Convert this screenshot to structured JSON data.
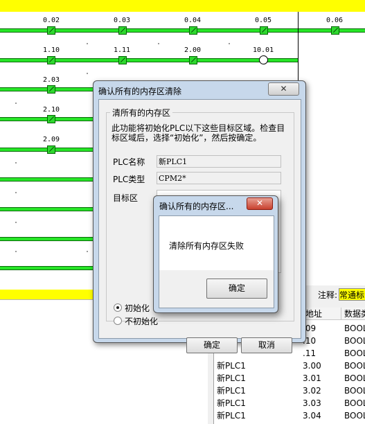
{
  "ladder": {
    "rungs": [
      {
        "contacts": [
          "0.02",
          "0.03",
          "0.04",
          "0.05"
        ],
        "extra": "0.06"
      },
      {
        "contacts": [
          "1.10",
          "1.11",
          "2.00"
        ],
        "coil": "10.01"
      },
      {
        "contacts": [
          "2.03"
        ]
      },
      {
        "contacts": [
          "2.10"
        ]
      },
      {
        "contacts": [
          "2.09"
        ]
      }
    ]
  },
  "note": {
    "label": "注释:",
    "value": "常通标"
  },
  "table": {
    "headers": [
      "地址",
      "数据类"
    ],
    "rows": [
      {
        "name": "",
        "addr": ".09",
        "type": "BOOL"
      },
      {
        "name": "",
        "addr": ".10",
        "type": "BOOL"
      },
      {
        "name": "",
        "addr": ".11",
        "type": "BOOL"
      },
      {
        "name": "新PLC1",
        "addr": "3.00",
        "type": "BOOL"
      },
      {
        "name": "新PLC1",
        "addr": "3.01",
        "type": "BOOL"
      },
      {
        "name": "新PLC1",
        "addr": "3.02",
        "type": "BOOL"
      },
      {
        "name": "新PLC1",
        "addr": "3.03",
        "type": "BOOL"
      },
      {
        "name": "新PLC1",
        "addr": "3.04",
        "type": "BOOL"
      }
    ]
  },
  "dialog": {
    "title": "确认所有的内存区清除",
    "close": "✕",
    "group_title": "清所有的内存区",
    "description": "此功能将初始化PLC以下这些目标区域。检查目标区域后，选择“初始化”，然后按确定。",
    "plc_name_label": "PLC名称",
    "plc_name_value": "新PLC1",
    "plc_type_label": "PLC类型",
    "plc_type_value": "CPM2*",
    "target_label": "目标区",
    "radio_init": "初始化",
    "radio_no_init": "不初始化",
    "ok": "确定",
    "cancel": "取消"
  },
  "alert": {
    "title": "确认所有的内存区...",
    "close": "✕",
    "message": "清除所有内存区失败",
    "ok": "确定"
  },
  "colors": {
    "rail": "#27e627",
    "yellow": "#ffff00",
    "dialog_frame": "#c7d8eb"
  }
}
